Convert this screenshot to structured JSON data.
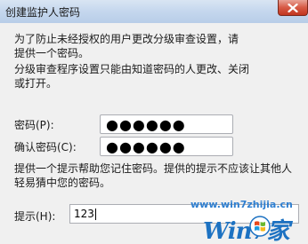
{
  "window": {
    "title": "创建监护人密码"
  },
  "intro": {
    "paragraph1": "为了防止未经授权的用户更改分级审查设置，请提供一个密码。",
    "paragraph2": "分级审查程序设置只能由知道密码的人更改、关闭或打开。"
  },
  "password": {
    "label": "密码(P):",
    "value": "●●●●●●"
  },
  "confirm": {
    "label": "确认密码(C):",
    "value": "●●●●●●"
  },
  "hint_info": {
    "paragraph": "提供一个提示帮助您记住密码。提供的提示不应该让其他人轻易猜中您的密码。"
  },
  "hint": {
    "label": "提示(H):",
    "value": "123"
  },
  "watermark": {
    "url": "www.win7zhijia.cn",
    "logo_text": "Win7家"
  },
  "icons": {
    "close": "close-icon",
    "logo": "windows-flag-icon"
  }
}
